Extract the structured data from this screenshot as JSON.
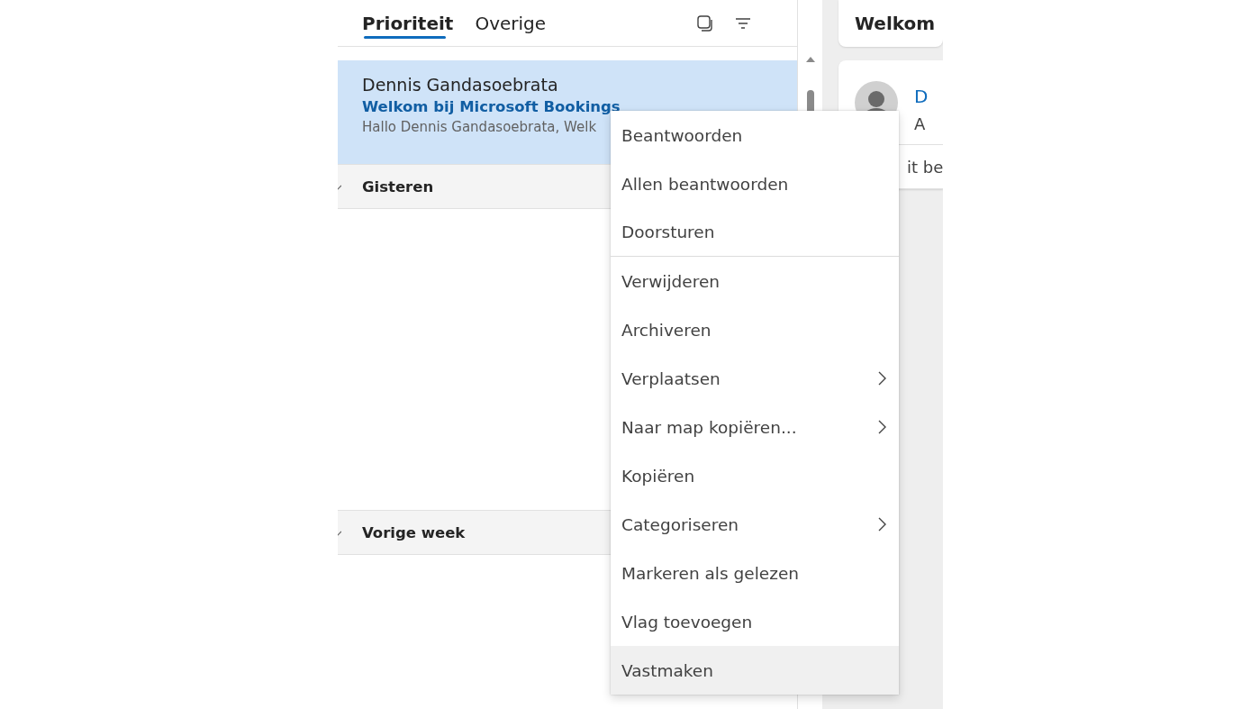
{
  "tabs": [
    {
      "label": "Prioriteit",
      "selected": true
    },
    {
      "label": "Overige",
      "selected": false
    }
  ],
  "selected_message": {
    "sender": "Dennis Gandasoebrata",
    "subject": "Welkom bij Microsoft Bookings",
    "preview": "Hallo Dennis Gandasoebrata, Welk"
  },
  "groups": [
    {
      "label": "Gisteren"
    },
    {
      "label": "Vorige week"
    }
  ],
  "reading_pane": {
    "title": "Welkom",
    "sender_initial": "D",
    "line_2": "A",
    "line_3": "it be"
  },
  "context_menu": [
    {
      "label": "Beantwoorden",
      "submenu": false,
      "highlighted": false,
      "divider_after": false
    },
    {
      "label": "Allen beantwoorden",
      "submenu": false,
      "highlighted": false,
      "divider_after": false
    },
    {
      "label": "Doorsturen",
      "submenu": false,
      "highlighted": false,
      "divider_after": true
    },
    {
      "label": "Verwijderen",
      "submenu": false,
      "highlighted": false,
      "divider_after": false
    },
    {
      "label": "Archiveren",
      "submenu": false,
      "highlighted": false,
      "divider_after": false
    },
    {
      "label": "Verplaatsen",
      "submenu": true,
      "highlighted": false,
      "divider_after": false
    },
    {
      "label": "Naar map kopiëren...",
      "submenu": true,
      "highlighted": false,
      "divider_after": false
    },
    {
      "label": "Kopiëren",
      "submenu": false,
      "highlighted": false,
      "divider_after": false
    },
    {
      "label": "Categoriseren",
      "submenu": true,
      "highlighted": false,
      "divider_after": false
    },
    {
      "label": "Markeren als gelezen",
      "submenu": false,
      "highlighted": false,
      "divider_after": false
    },
    {
      "label": "Vlag toevoegen",
      "submenu": false,
      "highlighted": false,
      "divider_after": false
    },
    {
      "label": "Vastmaken",
      "submenu": false,
      "highlighted": true,
      "divider_after": false
    }
  ]
}
